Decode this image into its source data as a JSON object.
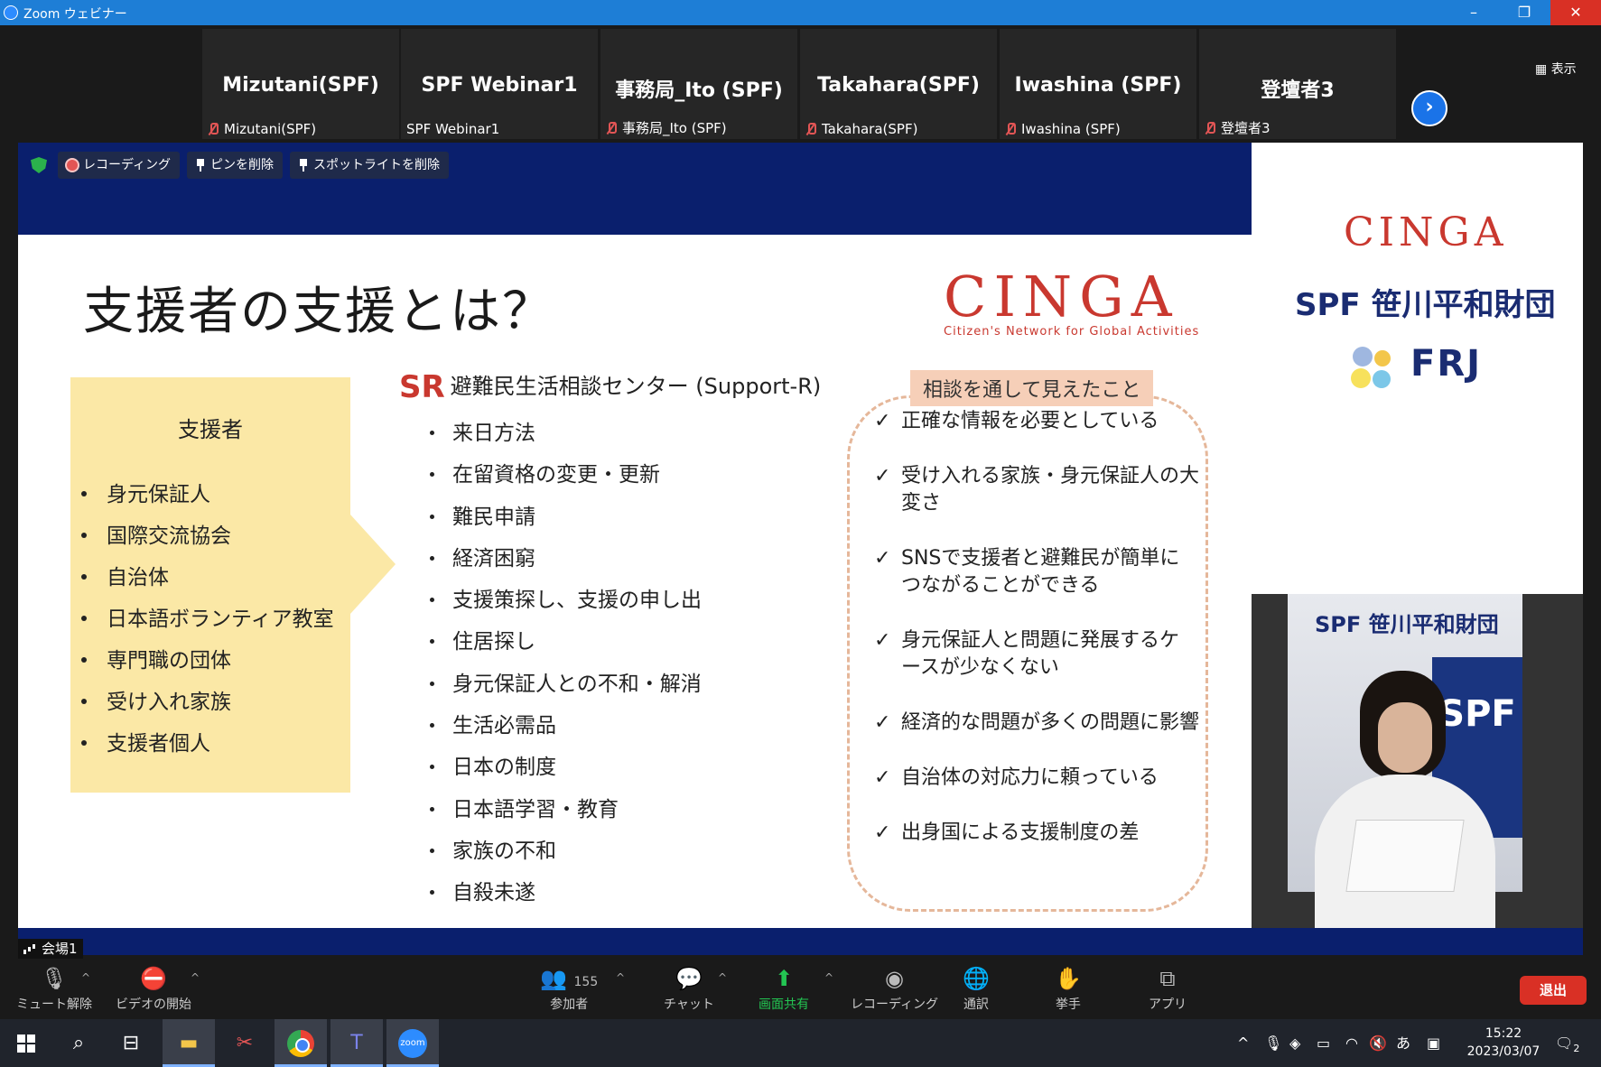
{
  "window": {
    "title": "Zoom ウェビナー"
  },
  "gallery": {
    "view_label": "表示",
    "participants": [
      {
        "display": "Mizutani(SPF)",
        "name": "Mizutani(SPF)",
        "muted": true
      },
      {
        "display": "SPF Webinar1",
        "name": "SPF Webinar1",
        "muted": false
      },
      {
        "display": "事務局_Ito (SPF)",
        "name": "事務局_Ito (SPF)",
        "muted": true
      },
      {
        "display": "Takahara(SPF)",
        "name": "Takahara(SPF)",
        "muted": true
      },
      {
        "display": "Iwashina (SPF)",
        "name": "Iwashina (SPF)",
        "muted": true
      },
      {
        "display": "登壇者3",
        "name": "登壇者3",
        "muted": true
      }
    ]
  },
  "meeting_tools": {
    "recording": "レコーディング",
    "unpin": "ピンを削除",
    "unspotlight": "スポットライトを削除"
  },
  "slide": {
    "title": "支援者の支援とは？",
    "logo": "CINGA",
    "logo_sub": "Citizen's Network for Global Activities",
    "supporters": {
      "heading": "支援者",
      "items": [
        "身元保証人",
        "国際交流協会",
        "自治体",
        "日本語ボランティア教室",
        "専門職の団体",
        "受け入れ家族",
        "支援者個人"
      ]
    },
    "sr": {
      "mark": "SR",
      "heading": "避難民生活相談センター (Support-R)",
      "items": [
        "来日方法",
        "在留資格の変更・更新",
        "難民申請",
        "経済困窮",
        "支援策探し、支援の申し出",
        "住居探し",
        "身元保証人との不和・解消",
        "生活必需品",
        "日本の制度",
        "日本語学習・教育",
        "家族の不和",
        "自殺未遂"
      ]
    },
    "findings": {
      "tag": "相談を通して見えたこと",
      "check": "✓",
      "items": [
        "正確な情報を必要としている",
        "受け入れる家族・身元保証人の大変さ",
        "SNSで支援者と避難民が簡単につながることができる",
        "身元保証人と問題に発展するケースが少なくない",
        "経済的な問題が多くの問題に影響",
        "自治体の対応力に頼っている",
        "出身国による支援制度の差"
      ]
    }
  },
  "side_logos": {
    "cinga": "CINGA",
    "spf": "SPF 笹川平和財団",
    "frj": "FRJ"
  },
  "speaker_video": {
    "banner": "SPF 笹川平和財団",
    "panel": "SPF"
  },
  "venue_label": "会場1",
  "toolbar": {
    "mute": "ミュート解除",
    "video": "ビデオの開始",
    "participants": "参加者",
    "participant_count": "155",
    "chat": "チャット",
    "share": "画面共有",
    "record": "レコーディング",
    "interpret": "通訳",
    "raise_hand": "挙手",
    "apps": "アプリ",
    "leave": "退出"
  },
  "taskbar": {
    "time": "15:22",
    "date": "2023/03/07",
    "ime": "あ",
    "zoom": "zoom",
    "notifications": "2"
  },
  "colors": {
    "accent_red": "#c9382f",
    "slide_navy": "#0a1f6d",
    "supporter_yellow": "#fbe8a6",
    "share_green": "#23c552",
    "leave_red": "#d93025"
  }
}
